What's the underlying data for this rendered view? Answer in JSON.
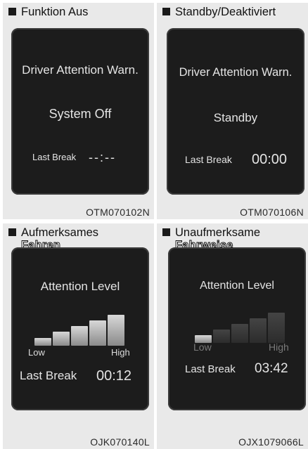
{
  "panels": [
    {
      "caption": "Funktion Aus",
      "screen_title": "Driver Attention Warn.",
      "status": "System Off",
      "last_break_label": "Last Break",
      "last_break_value": "--:--",
      "code": "OTM070102N"
    },
    {
      "caption": "Standby/Deaktiviert",
      "screen_title": "Driver Attention Warn.",
      "status": "Standby",
      "last_break_label": "Last Break",
      "last_break_value": "00:00",
      "code": "OTM070106N"
    },
    {
      "caption_line1": "Aufmerksames",
      "caption_line2": "Fahren",
      "screen_title": "Attention Level",
      "low_label": "Low",
      "high_label": "High",
      "level": 5,
      "level_max": 5,
      "last_break_label": "Last Break",
      "last_break_value": "00:12",
      "code": "OJK070140L"
    },
    {
      "caption_line1": "Unaufmerksame",
      "caption_line2": "Fahrweise",
      "screen_title": "Attention Level",
      "low_label": "Low",
      "high_label": "High",
      "level": 1,
      "level_max": 5,
      "last_break_label": "Last Break",
      "last_break_value": "03:42",
      "code": "OJX1079066L"
    }
  ],
  "colors": {
    "panel_bg": "#e9e9e9",
    "screen_bg": "#1c1c1c",
    "screen_text": "#e4e4e4",
    "bar_active": "#bdbdbd",
    "bar_inactive": "#3a3a3a"
  }
}
